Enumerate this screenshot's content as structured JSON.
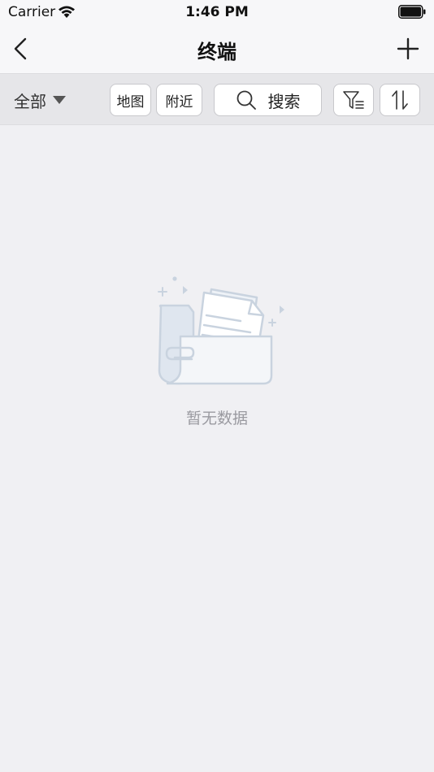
{
  "status_bar": {
    "carrier": "Carrier",
    "time": "1:46 PM"
  },
  "nav": {
    "title": "终端",
    "back_icon": "chevron-left-icon",
    "add_icon": "plus-icon"
  },
  "toolbar": {
    "all_filter_label": "全部",
    "map_label": "地图",
    "nearby_label": "附近",
    "search_label": "搜索",
    "filter_icon": "filter-icon",
    "sort_icon": "sort-icon"
  },
  "empty_state": {
    "message": "暂无数据",
    "illustration": "empty-folder-illustration"
  },
  "colors": {
    "background": "#f0f0f3",
    "toolbar_bg": "#e6e6e9",
    "empty_text": "#9a9aa0",
    "illustration_stroke": "#c9d3df"
  }
}
